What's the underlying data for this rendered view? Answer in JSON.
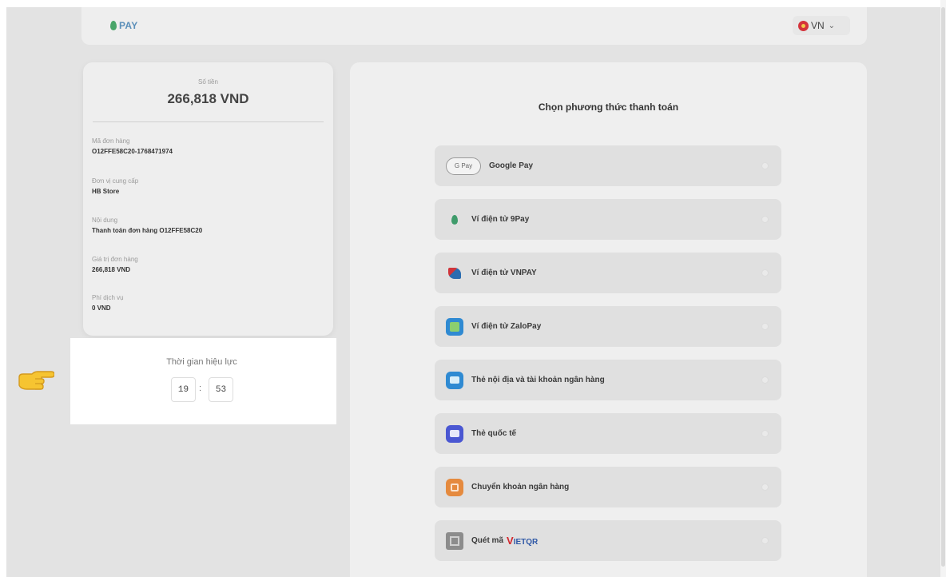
{
  "header": {
    "logo_text": "PAY",
    "language": {
      "code": "VN",
      "flag": "vietnam-flag"
    }
  },
  "summary": {
    "amount_label": "Số tiền",
    "amount": "266,818 VND",
    "fields": [
      {
        "label": "Mã đơn hàng",
        "value": "O12FFE58C20-1768471974"
      },
      {
        "label": "Đơn vị cung cấp",
        "value": "HB Store"
      },
      {
        "label": "Nội dung",
        "value": "Thanh toán đơn hàng O12FFE58C20"
      },
      {
        "label": "Giá trị đơn hàng",
        "value": "266,818 VND"
      },
      {
        "label": "Phí dịch vụ",
        "value": "0 VND"
      }
    ]
  },
  "timer": {
    "label": "Thời gian hiệu lực",
    "minutes": "19",
    "separator": ":",
    "seconds": "53"
  },
  "payment": {
    "title": "Chọn phương thức thanh toán",
    "methods": [
      {
        "label": "Google Pay",
        "icon": "google-pay-icon",
        "icon_text": "G Pay"
      },
      {
        "label": "Ví điện tử 9Pay",
        "icon": "9pay-icon"
      },
      {
        "label": "Ví điện tử VNPAY",
        "icon": "vnpay-icon"
      },
      {
        "label": "Ví điện tử ZaloPay",
        "icon": "zalopay-icon"
      },
      {
        "label": "Thẻ nội địa và tài khoản ngân hàng",
        "icon": "domestic-card-icon"
      },
      {
        "label": "Thẻ quốc tế",
        "icon": "international-card-icon"
      },
      {
        "label": "Chuyển khoản ngân hàng",
        "icon": "bank-transfer-icon"
      },
      {
        "label": "Quét mã",
        "icon": "qr-code-icon",
        "brand_v": "V",
        "brand_rest": "IETQR"
      }
    ]
  },
  "colors": {
    "page_background": "#e3e3e3",
    "card_background": "#eeeeee",
    "method_background": "#e0e0e0",
    "highlight_background": "#ffffff",
    "brand_green": "#4aa56a",
    "brand_blue": "#5b8fb9"
  }
}
